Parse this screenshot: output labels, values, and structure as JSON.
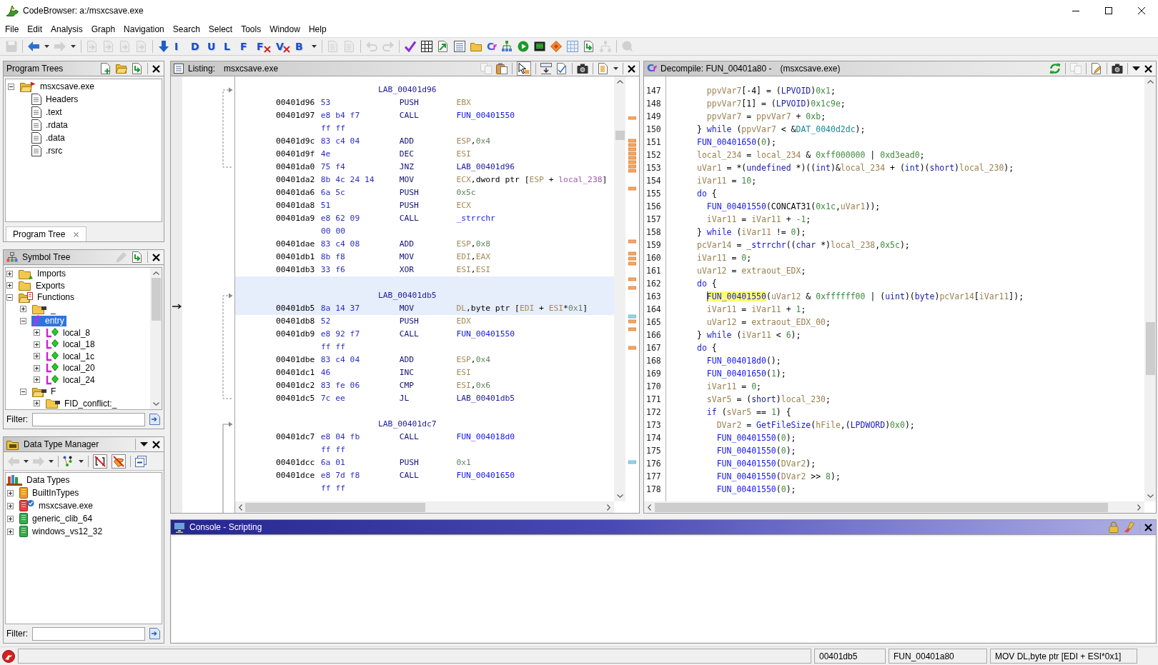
{
  "window": {
    "title": "CodeBrowser: a:/msxcsave.exe"
  },
  "menu": [
    "File",
    "Edit",
    "Analysis",
    "Graph",
    "Navigation",
    "Search",
    "Select",
    "Tools",
    "Window",
    "Help"
  ],
  "toolbar": [
    [
      {
        "kind": "save",
        "disabled": true
      }
    ],
    [
      {
        "kind": "back",
        "disabled": false,
        "dropdown": true
      },
      {
        "kind": "forward",
        "disabled": true,
        "dropdown": true
      }
    ],
    [
      {
        "kind": "page-nav",
        "disabled": true
      },
      {
        "kind": "page-nav",
        "disabled": true
      },
      {
        "kind": "page-nav",
        "disabled": true
      },
      {
        "kind": "page-nav",
        "disabled": true
      }
    ],
    [
      {
        "kind": "down-arrow",
        "disabled": false
      },
      {
        "kind": "letter",
        "glyph": "I",
        "crossed": false
      },
      {
        "kind": "letter",
        "glyph": "D",
        "crossed": false
      },
      {
        "kind": "letter",
        "glyph": "U",
        "crossed": false
      },
      {
        "kind": "letter",
        "glyph": "L",
        "crossed": false
      },
      {
        "kind": "letter",
        "glyph": "F",
        "crossed": false
      },
      {
        "kind": "letter",
        "glyph": "F",
        "crossed": true
      },
      {
        "kind": "letter",
        "glyph": "V",
        "crossed": true
      },
      {
        "kind": "letter",
        "glyph": "B",
        "crossed": false,
        "dropdown": true
      }
    ],
    [
      {
        "kind": "page-tool",
        "disabled": true
      },
      {
        "kind": "page-tool",
        "disabled": true
      }
    ],
    [
      {
        "kind": "undo",
        "disabled": true
      },
      {
        "kind": "redo",
        "disabled": true
      }
    ],
    [
      {
        "kind": "check",
        "disabled": false
      },
      {
        "kind": "grid-box",
        "disabled": false
      },
      {
        "kind": "export",
        "disabled": false
      },
      {
        "kind": "list",
        "disabled": false
      },
      {
        "kind": "folder",
        "disabled": false
      },
      {
        "kind": "glyph",
        "glyph": "Cf"
      },
      {
        "kind": "tree-graph",
        "disabled": false
      },
      {
        "kind": "play",
        "disabled": false
      },
      {
        "kind": "chip",
        "disabled": false
      },
      {
        "kind": "diamond",
        "disabled": false
      },
      {
        "kind": "table",
        "disabled": false
      },
      {
        "kind": "page-arrow",
        "disabled": false
      },
      {
        "kind": "hierarchy",
        "disabled": true
      }
    ],
    [
      {
        "kind": "bubble",
        "disabled": true
      }
    ]
  ],
  "program_trees": {
    "title": "Program Trees",
    "focused": false,
    "tools": [
      [
        {
          "kind": "page-plus",
          "disabled": false
        },
        {
          "kind": "folder-open",
          "disabled": false
        },
        {
          "kind": "page-arrow",
          "disabled": false
        }
      ]
    ],
    "tree": [
      {
        "label": "msxcsave.exe",
        "kind": "program",
        "expanded": true,
        "selected": false,
        "children": [
          {
            "label": "Headers",
            "kind": "fragment",
            "selected": false
          },
          {
            "label": ".text",
            "kind": "fragment",
            "selected": false
          },
          {
            "label": ".rdata",
            "kind": "fragment",
            "selected": false
          },
          {
            "label": ".data",
            "kind": "fragment",
            "selected": false
          },
          {
            "label": ".rsrc",
            "kind": "fragment",
            "selected": false
          }
        ]
      }
    ],
    "tabs": [
      {
        "label": "Program Tree",
        "selected": true
      }
    ]
  },
  "symbol_tree": {
    "title": "Symbol Tree",
    "focused": false,
    "tools": [
      [
        {
          "kind": "pencil",
          "disabled": true
        },
        {
          "kind": "page-arrow",
          "disabled": false
        }
      ]
    ],
    "tree": [
      {
        "label": "Imports",
        "kind": "imports",
        "expanded": false,
        "selected": false
      },
      {
        "label": "Exports",
        "kind": "exports",
        "expanded": false,
        "selected": false
      },
      {
        "label": "Functions",
        "kind": "functions",
        "expanded": true,
        "selected": false,
        "children": [
          {
            "label": "_",
            "kind": "namespace",
            "expanded": false,
            "selected": false
          },
          {
            "label": "entry",
            "kind": "function",
            "expanded": true,
            "selected": true,
            "children": [
              {
                "label": "local_8",
                "kind": "local",
                "expanded": false,
                "selected": false
              },
              {
                "label": "local_18",
                "kind": "local",
                "expanded": false,
                "selected": false
              },
              {
                "label": "local_1c",
                "kind": "local",
                "expanded": false,
                "selected": false
              },
              {
                "label": "local_20",
                "kind": "local",
                "expanded": false,
                "selected": false
              },
              {
                "label": "local_24",
                "kind": "local",
                "expanded": false,
                "selected": false
              }
            ]
          },
          {
            "label": "F",
            "kind": "namespace",
            "expanded": true,
            "selected": false,
            "children": [
              {
                "label": "FID_conflict:_",
                "kind": "namespace",
                "expanded": false,
                "selected": false
              }
            ]
          }
        ]
      }
    ],
    "filter": {
      "label": "Filter:"
    }
  },
  "data_type_manager": {
    "title": "Data Type Manager",
    "focused": false,
    "tools": [
      [
        {
          "kind": "menu",
          "disabled": false
        }
      ]
    ],
    "toolbar": [
      [
        {
          "kind": "back",
          "disabled": true,
          "dropdown": true
        },
        {
          "kind": "forward",
          "disabled": true,
          "dropdown": true
        }
      ],
      [
        {
          "kind": "node-graph",
          "disabled": false,
          "dropdown": true
        }
      ],
      [
        {
          "kind": "no-arrays",
          "disabled": false,
          "on": true
        },
        {
          "kind": "no-pointers",
          "disabled": false,
          "on": true
        }
      ],
      [
        {
          "kind": "collapse",
          "disabled": false
        }
      ]
    ],
    "tree": [
      {
        "label": "Data Types",
        "kind": "root",
        "selected": false,
        "children": [
          {
            "label": "BuiltInTypes",
            "kind": "builtin",
            "expanded": false,
            "selected": false
          },
          {
            "label": "msxcsave.exe",
            "kind": "program-archive",
            "expanded": false,
            "selected": false
          },
          {
            "label": "generic_clib_64",
            "kind": "archive",
            "expanded": false,
            "selected": false
          },
          {
            "label": "windows_vs12_32",
            "kind": "archive",
            "expanded": false,
            "selected": false
          }
        ]
      }
    ],
    "filter": {
      "label": "Filter:"
    }
  },
  "listing": {
    "title": "Listing:",
    "program": "msxcsave.exe",
    "focused": false,
    "tools": [
      [
        {
          "kind": "copy",
          "disabled": true
        },
        {
          "kind": "paste",
          "disabled": false
        }
      ],
      [
        {
          "kind": "pointer",
          "disabled": false,
          "on": true
        }
      ],
      [
        {
          "kind": "field-header",
          "disabled": false
        },
        {
          "kind": "diff",
          "disabled": false
        }
      ],
      [
        {
          "kind": "camera",
          "disabled": false
        }
      ],
      [
        {
          "kind": "page-menu",
          "disabled": false,
          "dropdown": true
        }
      ]
    ],
    "rows": [
      {
        "kind": "label",
        "label": "LAB_00401d96",
        "selected": false
      },
      {
        "kind": "instruction",
        "address": "00401d96",
        "bytes": "53",
        "mnemonic": "PUSH",
        "operands": [
          {
            "kind": "register",
            "text": "EBX"
          }
        ],
        "selected": false
      },
      {
        "kind": "instruction",
        "address": "00401d97",
        "bytes": "e8 b4 f7",
        "mnemonic": "CALL",
        "operands": [
          {
            "kind": "function",
            "text": "FUN_00401550"
          }
        ],
        "selected": false
      },
      {
        "kind": "bytes",
        "bytes": "ff ff",
        "selected": false
      },
      {
        "kind": "instruction",
        "address": "00401d9c",
        "bytes": "83 c4 04",
        "mnemonic": "ADD",
        "operands": [
          {
            "kind": "register",
            "text": "ESP"
          },
          {
            "kind": "plain",
            "text": ","
          },
          {
            "kind": "scalar",
            "text": "0x4"
          }
        ],
        "selected": false
      },
      {
        "kind": "instruction",
        "address": "00401d9f",
        "bytes": "4e",
        "mnemonic": "DEC",
        "operands": [
          {
            "kind": "register",
            "text": "ESI"
          }
        ],
        "selected": false
      },
      {
        "kind": "instruction",
        "address": "00401da0",
        "bytes": "75 f4",
        "mnemonic": "JNZ",
        "operands": [
          {
            "kind": "label",
            "text": "LAB_00401d96"
          }
        ],
        "selected": false
      },
      {
        "kind": "instruction",
        "address": "00401da2",
        "bytes": "8b 4c 24 14",
        "mnemonic": "MOV",
        "operands": [
          {
            "kind": "register",
            "text": "ECX"
          },
          {
            "kind": "plain",
            "text": ",dword ptr ["
          },
          {
            "kind": "register",
            "text": "ESP"
          },
          {
            "kind": "plain",
            "text": " + "
          },
          {
            "kind": "variable",
            "text": "local_238"
          },
          {
            "kind": "plain",
            "text": "]"
          }
        ],
        "selected": false
      },
      {
        "kind": "instruction",
        "address": "00401da6",
        "bytes": "6a 5c",
        "mnemonic": "PUSH",
        "operands": [
          {
            "kind": "scalar",
            "text": "0x5c"
          }
        ],
        "selected": false
      },
      {
        "kind": "instruction",
        "address": "00401da8",
        "bytes": "51",
        "mnemonic": "PUSH",
        "operands": [
          {
            "kind": "register",
            "text": "ECX"
          }
        ],
        "selected": false
      },
      {
        "kind": "instruction",
        "address": "00401da9",
        "bytes": "e8 62 09",
        "mnemonic": "CALL",
        "operands": [
          {
            "kind": "function",
            "text": "_strrchr"
          }
        ],
        "selected": false
      },
      {
        "kind": "bytes",
        "bytes": "00 00",
        "selected": false
      },
      {
        "kind": "instruction",
        "address": "00401dae",
        "bytes": "83 c4 08",
        "mnemonic": "ADD",
        "operands": [
          {
            "kind": "register",
            "text": "ESP"
          },
          {
            "kind": "plain",
            "text": ","
          },
          {
            "kind": "scalar",
            "text": "0x8"
          }
        ],
        "selected": false
      },
      {
        "kind": "instruction",
        "address": "00401db1",
        "bytes": "8b f8",
        "mnemonic": "MOV",
        "operands": [
          {
            "kind": "register",
            "text": "EDI"
          },
          {
            "kind": "plain",
            "text": ","
          },
          {
            "kind": "register",
            "text": "EAX"
          }
        ],
        "selected": false
      },
      {
        "kind": "instruction",
        "address": "00401db3",
        "bytes": "33 f6",
        "mnemonic": "XOR",
        "operands": [
          {
            "kind": "register",
            "text": "ESI"
          },
          {
            "kind": "plain",
            "text": ","
          },
          {
            "kind": "register",
            "text": "ESI"
          }
        ],
        "selected": false
      },
      {
        "kind": "label",
        "label": "LAB_00401db5",
        "selected": true
      },
      {
        "kind": "instruction",
        "address": "00401db5",
        "bytes": "8a 14 37",
        "mnemonic": "MOV",
        "operands": [
          {
            "kind": "register",
            "text": "DL"
          },
          {
            "kind": "plain",
            "text": ",byte ptr ["
          },
          {
            "kind": "register",
            "text": "EDI"
          },
          {
            "kind": "plain",
            "text": " + "
          },
          {
            "kind": "register",
            "text": "ESI"
          },
          {
            "kind": "plain",
            "text": "*"
          },
          {
            "kind": "scalar",
            "text": "0x1"
          },
          {
            "kind": "plain",
            "text": "]"
          }
        ],
        "selected": true
      },
      {
        "kind": "instruction",
        "address": "00401db8",
        "bytes": "52",
        "mnemonic": "PUSH",
        "operands": [
          {
            "kind": "register",
            "text": "EDX"
          }
        ],
        "selected": false
      },
      {
        "kind": "instruction",
        "address": "00401db9",
        "bytes": "e8 92 f7",
        "mnemonic": "CALL",
        "operands": [
          {
            "kind": "function",
            "text": "FUN_00401550"
          }
        ],
        "selected": false
      },
      {
        "kind": "bytes",
        "bytes": "ff ff",
        "selected": false
      },
      {
        "kind": "instruction",
        "address": "00401dbe",
        "bytes": "83 c4 04",
        "mnemonic": "ADD",
        "operands": [
          {
            "kind": "register",
            "text": "ESP"
          },
          {
            "kind": "plain",
            "text": ","
          },
          {
            "kind": "scalar",
            "text": "0x4"
          }
        ],
        "selected": false
      },
      {
        "kind": "instruction",
        "address": "00401dc1",
        "bytes": "46",
        "mnemonic": "INC",
        "operands": [
          {
            "kind": "register",
            "text": "ESI"
          }
        ],
        "selected": false
      },
      {
        "kind": "instruction",
        "address": "00401dc2",
        "bytes": "83 fe 06",
        "mnemonic": "CMP",
        "operands": [
          {
            "kind": "register",
            "text": "ESI"
          },
          {
            "kind": "plain",
            "text": ","
          },
          {
            "kind": "scalar",
            "text": "0x6"
          }
        ],
        "selected": false
      },
      {
        "kind": "instruction",
        "address": "00401dc5",
        "bytes": "7c ee",
        "mnemonic": "JL",
        "operands": [
          {
            "kind": "label",
            "text": "LAB_00401db5"
          }
        ],
        "selected": false
      },
      {
        "kind": "label",
        "label": "LAB_00401dc7",
        "selected": false
      },
      {
        "kind": "instruction",
        "address": "00401dc7",
        "bytes": "e8 04 fb",
        "mnemonic": "CALL",
        "operands": [
          {
            "kind": "function",
            "text": "FUN_004018d0"
          }
        ],
        "selected": false
      },
      {
        "kind": "bytes",
        "bytes": "ff ff",
        "selected": false
      },
      {
        "kind": "instruction",
        "address": "00401dcc",
        "bytes": "6a 01",
        "mnemonic": "PUSH",
        "operands": [
          {
            "kind": "scalar",
            "text": "0x1"
          }
        ],
        "selected": false
      },
      {
        "kind": "instruction",
        "address": "00401dce",
        "bytes": "e8 7d f8",
        "mnemonic": "CALL",
        "operands": [
          {
            "kind": "function",
            "text": "FUN_00401650"
          }
        ],
        "selected": false
      },
      {
        "kind": "bytes",
        "bytes": "ff ff",
        "selected": false
      }
    ]
  },
  "decompile": {
    "glyph": "Cf",
    "title": "Decompile: FUN_00401a80 -",
    "program": "(msxcsave.exe)",
    "focused": false,
    "tools": [
      [
        {
          "kind": "refresh",
          "disabled": false
        }
      ],
      [
        {
          "kind": "copy",
          "disabled": true
        }
      ],
      [
        {
          "kind": "edit",
          "disabled": false
        }
      ],
      [
        {
          "kind": "camera",
          "disabled": false
        }
      ],
      [
        {
          "kind": "menu",
          "disabled": false
        }
      ]
    ],
    "lines": [
      {
        "number": "147",
        "tokens": [
          {
            "kind": "variable",
            "text": "  ppvVar7"
          },
          {
            "kind": "plain",
            "text": "[-4] = ("
          },
          {
            "kind": "type",
            "text": "LPVOID"
          },
          {
            "kind": "plain",
            "text": ")"
          },
          {
            "kind": "constant",
            "text": "0x1"
          },
          {
            "kind": "plain",
            "text": ";"
          }
        ]
      },
      {
        "number": "148",
        "tokens": [
          {
            "kind": "variable",
            "text": "  ppvVar7"
          },
          {
            "kind": "plain",
            "text": "[1] = ("
          },
          {
            "kind": "type",
            "text": "LPVOID"
          },
          {
            "kind": "plain",
            "text": ")"
          },
          {
            "kind": "constant",
            "text": "0x1c9e"
          },
          {
            "kind": "plain",
            "text": ";"
          }
        ]
      },
      {
        "number": "149",
        "tokens": [
          {
            "kind": "variable",
            "text": "  ppvVar7"
          },
          {
            "kind": "plain",
            "text": " = "
          },
          {
            "kind": "variable",
            "text": "ppvVar7"
          },
          {
            "kind": "plain",
            "text": " + "
          },
          {
            "kind": "constant",
            "text": "0xb"
          },
          {
            "kind": "plain",
            "text": ";"
          }
        ]
      },
      {
        "number": "150",
        "tokens": [
          {
            "kind": "plain",
            "text": "} "
          },
          {
            "kind": "keyword",
            "text": "while"
          },
          {
            "kind": "plain",
            "text": " ("
          },
          {
            "kind": "variable",
            "text": "ppvVar7"
          },
          {
            "kind": "plain",
            "text": " < &"
          },
          {
            "kind": "global",
            "text": "DAT_0040d2dc"
          },
          {
            "kind": "plain",
            "text": ");"
          }
        ]
      },
      {
        "number": "151",
        "tokens": [
          {
            "kind": "function",
            "text": "FUN_00401650"
          },
          {
            "kind": "plain",
            "text": "("
          },
          {
            "kind": "constant",
            "text": "0"
          },
          {
            "kind": "plain",
            "text": ");"
          }
        ]
      },
      {
        "number": "152",
        "tokens": [
          {
            "kind": "variable",
            "text": "local_234"
          },
          {
            "kind": "plain",
            "text": " = "
          },
          {
            "kind": "variable",
            "text": "local_234"
          },
          {
            "kind": "plain",
            "text": " & "
          },
          {
            "kind": "constant",
            "text": "0xff000000"
          },
          {
            "kind": "plain",
            "text": " | "
          },
          {
            "kind": "constant",
            "text": "0xd3ead0"
          },
          {
            "kind": "plain",
            "text": ";"
          }
        ]
      },
      {
        "number": "153",
        "tokens": [
          {
            "kind": "variable",
            "text": "uVar1"
          },
          {
            "kind": "plain",
            "text": " = *("
          },
          {
            "kind": "type",
            "text": "undefined"
          },
          {
            "kind": "plain",
            "text": " *)(("
          },
          {
            "kind": "type",
            "text": "int"
          },
          {
            "kind": "plain",
            "text": ")&"
          },
          {
            "kind": "variable",
            "text": "local_234"
          },
          {
            "kind": "plain",
            "text": " + ("
          },
          {
            "kind": "type",
            "text": "int"
          },
          {
            "kind": "plain",
            "text": ")("
          },
          {
            "kind": "type",
            "text": "short"
          },
          {
            "kind": "plain",
            "text": ")"
          },
          {
            "kind": "variable",
            "text": "local_230"
          },
          {
            "kind": "plain",
            "text": ");"
          }
        ]
      },
      {
        "number": "154",
        "tokens": [
          {
            "kind": "variable",
            "text": "iVar11"
          },
          {
            "kind": "plain",
            "text": " = "
          },
          {
            "kind": "constant",
            "text": "10"
          },
          {
            "kind": "plain",
            "text": ";"
          }
        ]
      },
      {
        "number": "155",
        "tokens": [
          {
            "kind": "keyword",
            "text": "do"
          },
          {
            "kind": "plain",
            "text": " {"
          }
        ]
      },
      {
        "number": "156",
        "tokens": [
          {
            "kind": "function",
            "text": "  FUN_00401550"
          },
          {
            "kind": "plain",
            "text": "(CONCAT31("
          },
          {
            "kind": "constant",
            "text": "0x1c"
          },
          {
            "kind": "plain",
            "text": ","
          },
          {
            "kind": "variable",
            "text": "uVar1"
          },
          {
            "kind": "plain",
            "text": "));"
          }
        ]
      },
      {
        "number": "157",
        "tokens": [
          {
            "kind": "variable",
            "text": "  iVar11"
          },
          {
            "kind": "plain",
            "text": " = "
          },
          {
            "kind": "variable",
            "text": "iVar11"
          },
          {
            "kind": "plain",
            "text": " + "
          },
          {
            "kind": "constant",
            "text": "-1"
          },
          {
            "kind": "plain",
            "text": ";"
          }
        ]
      },
      {
        "number": "158",
        "tokens": [
          {
            "kind": "plain",
            "text": "} "
          },
          {
            "kind": "keyword",
            "text": "while"
          },
          {
            "kind": "plain",
            "text": " ("
          },
          {
            "kind": "variable",
            "text": "iVar11"
          },
          {
            "kind": "plain",
            "text": " != "
          },
          {
            "kind": "constant",
            "text": "0"
          },
          {
            "kind": "plain",
            "text": ");"
          }
        ]
      },
      {
        "number": "159",
        "tokens": [
          {
            "kind": "variable",
            "text": "pcVar14"
          },
          {
            "kind": "plain",
            "text": " = "
          },
          {
            "kind": "function",
            "text": "_strrchr"
          },
          {
            "kind": "plain",
            "text": "(("
          },
          {
            "kind": "type",
            "text": "char"
          },
          {
            "kind": "plain",
            "text": " *)"
          },
          {
            "kind": "variable",
            "text": "local_238"
          },
          {
            "kind": "plain",
            "text": ","
          },
          {
            "kind": "constant",
            "text": "0x5c"
          },
          {
            "kind": "plain",
            "text": ");"
          }
        ]
      },
      {
        "number": "160",
        "tokens": [
          {
            "kind": "variable",
            "text": "iVar11"
          },
          {
            "kind": "plain",
            "text": " = "
          },
          {
            "kind": "constant",
            "text": "0"
          },
          {
            "kind": "plain",
            "text": ";"
          }
        ]
      },
      {
        "number": "161",
        "tokens": [
          {
            "kind": "variable",
            "text": "uVar12"
          },
          {
            "kind": "plain",
            "text": " = "
          },
          {
            "kind": "variable",
            "text": "extraout_EDX"
          },
          {
            "kind": "plain",
            "text": ";"
          }
        ]
      },
      {
        "number": "162",
        "tokens": [
          {
            "kind": "keyword",
            "text": "do"
          },
          {
            "kind": "plain",
            "text": " {"
          }
        ]
      },
      {
        "number": "163",
        "tokens": [
          {
            "kind": "function",
            "text": "  FUN_00401550",
            "highlighted": true
          },
          {
            "kind": "plain",
            "text": "("
          },
          {
            "kind": "variable",
            "text": "uVar12"
          },
          {
            "kind": "plain",
            "text": " & "
          },
          {
            "kind": "constant",
            "text": "0xffffff00"
          },
          {
            "kind": "plain",
            "text": " | ("
          },
          {
            "kind": "type",
            "text": "uint"
          },
          {
            "kind": "plain",
            "text": ")("
          },
          {
            "kind": "type",
            "text": "byte"
          },
          {
            "kind": "plain",
            "text": ")"
          },
          {
            "kind": "variable",
            "text": "pcVar14"
          },
          {
            "kind": "plain",
            "text": "["
          },
          {
            "kind": "variable",
            "text": "iVar11"
          },
          {
            "kind": "plain",
            "text": "]);"
          }
        ]
      },
      {
        "number": "164",
        "tokens": [
          {
            "kind": "variable",
            "text": "  iVar11"
          },
          {
            "kind": "plain",
            "text": " = "
          },
          {
            "kind": "variable",
            "text": "iVar11"
          },
          {
            "kind": "plain",
            "text": " + "
          },
          {
            "kind": "constant",
            "text": "1"
          },
          {
            "kind": "plain",
            "text": ";"
          }
        ]
      },
      {
        "number": "165",
        "tokens": [
          {
            "kind": "variable",
            "text": "  uVar12"
          },
          {
            "kind": "plain",
            "text": " = "
          },
          {
            "kind": "variable",
            "text": "extraout_EDX_00"
          },
          {
            "kind": "plain",
            "text": ";"
          }
        ]
      },
      {
        "number": "166",
        "tokens": [
          {
            "kind": "plain",
            "text": "} "
          },
          {
            "kind": "keyword",
            "text": "while"
          },
          {
            "kind": "plain",
            "text": " ("
          },
          {
            "kind": "variable",
            "text": "iVar11"
          },
          {
            "kind": "plain",
            "text": " < "
          },
          {
            "kind": "constant",
            "text": "6"
          },
          {
            "kind": "plain",
            "text": ");"
          }
        ]
      },
      {
        "number": "167",
        "tokens": [
          {
            "kind": "keyword",
            "text": "do"
          },
          {
            "kind": "plain",
            "text": " {"
          }
        ]
      },
      {
        "number": "168",
        "tokens": [
          {
            "kind": "function",
            "text": "  FUN_004018d0"
          },
          {
            "kind": "plain",
            "text": "();"
          }
        ]
      },
      {
        "number": "169",
        "tokens": [
          {
            "kind": "function",
            "text": "  FUN_00401650"
          },
          {
            "kind": "plain",
            "text": "("
          },
          {
            "kind": "constant",
            "text": "1"
          },
          {
            "kind": "plain",
            "text": ");"
          }
        ]
      },
      {
        "number": "170",
        "tokens": [
          {
            "kind": "variable",
            "text": "  iVar11"
          },
          {
            "kind": "plain",
            "text": " = "
          },
          {
            "kind": "constant",
            "text": "0"
          },
          {
            "kind": "plain",
            "text": ";"
          }
        ]
      },
      {
        "number": "171",
        "tokens": [
          {
            "kind": "variable",
            "text": "  sVar5"
          },
          {
            "kind": "plain",
            "text": " = ("
          },
          {
            "kind": "type",
            "text": "short"
          },
          {
            "kind": "plain",
            "text": ")"
          },
          {
            "kind": "variable",
            "text": "local_230"
          },
          {
            "kind": "plain",
            "text": ";"
          }
        ]
      },
      {
        "number": "172",
        "tokens": [
          {
            "kind": "keyword",
            "text": "  if"
          },
          {
            "kind": "plain",
            "text": " ("
          },
          {
            "kind": "variable",
            "text": "sVar5"
          },
          {
            "kind": "plain",
            "text": " == "
          },
          {
            "kind": "constant",
            "text": "1"
          },
          {
            "kind": "plain",
            "text": ") {"
          }
        ]
      },
      {
        "number": "173",
        "tokens": [
          {
            "kind": "variable",
            "text": "    DVar2"
          },
          {
            "kind": "plain",
            "text": " = "
          },
          {
            "kind": "function",
            "text": "GetFileSize"
          },
          {
            "kind": "plain",
            "text": "("
          },
          {
            "kind": "variable",
            "text": "hFile"
          },
          {
            "kind": "plain",
            "text": ",("
          },
          {
            "kind": "type",
            "text": "LPDWORD"
          },
          {
            "kind": "plain",
            "text": ")"
          },
          {
            "kind": "constant",
            "text": "0x0"
          },
          {
            "kind": "plain",
            "text": ");"
          }
        ]
      },
      {
        "number": "174",
        "tokens": [
          {
            "kind": "function",
            "text": "    FUN_00401550"
          },
          {
            "kind": "plain",
            "text": "("
          },
          {
            "kind": "constant",
            "text": "0"
          },
          {
            "kind": "plain",
            "text": ");"
          }
        ]
      },
      {
        "number": "175",
        "tokens": [
          {
            "kind": "function",
            "text": "    FUN_00401550"
          },
          {
            "kind": "plain",
            "text": "("
          },
          {
            "kind": "constant",
            "text": "0"
          },
          {
            "kind": "plain",
            "text": ");"
          }
        ]
      },
      {
        "number": "176",
        "tokens": [
          {
            "kind": "function",
            "text": "    FUN_00401550"
          },
          {
            "kind": "plain",
            "text": "("
          },
          {
            "kind": "variable",
            "text": "DVar2"
          },
          {
            "kind": "plain",
            "text": ");"
          }
        ]
      },
      {
        "number": "177",
        "tokens": [
          {
            "kind": "function",
            "text": "    FUN_00401550"
          },
          {
            "kind": "plain",
            "text": "("
          },
          {
            "kind": "variable",
            "text": "DVar2"
          },
          {
            "kind": "plain",
            "text": " >> "
          },
          {
            "kind": "constant",
            "text": "8"
          },
          {
            "kind": "plain",
            "text": ");"
          }
        ]
      },
      {
        "number": "178",
        "tokens": [
          {
            "kind": "function",
            "text": "    FUN_00401550"
          },
          {
            "kind": "plain",
            "text": "("
          },
          {
            "kind": "constant",
            "text": "0"
          },
          {
            "kind": "plain",
            "text": ");"
          }
        ]
      }
    ]
  },
  "console": {
    "title": "Console - Scripting",
    "focused": true,
    "tools": [
      [
        {
          "kind": "lock",
          "disabled": false
        },
        {
          "kind": "broom",
          "disabled": false
        }
      ]
    ]
  },
  "status_bar": {
    "fields": [
      "00401db5",
      "FUN_00401a80",
      "MOV DL,byte ptr [EDI + ESI*0x1]"
    ]
  }
}
